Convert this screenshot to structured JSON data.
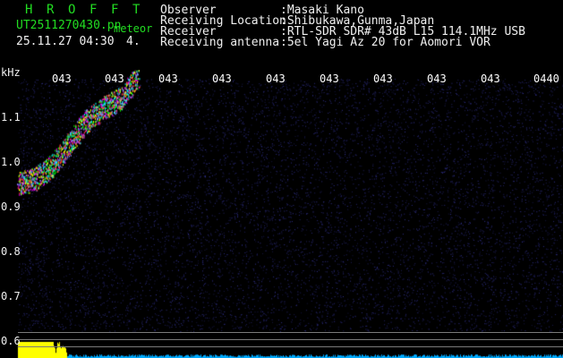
{
  "station": {
    "name_letters": [
      "H",
      "R",
      "O",
      "F",
      "F",
      "T"
    ],
    "file_name": "UT2511270430.pn",
    "file_suffix": "meteor",
    "date_time": "25.11.27 04:30",
    "count": "4."
  },
  "metadata": [
    {
      "label": "Observer",
      "value": ":Masaki Kano"
    },
    {
      "label": "Receiving Location",
      "value": ":Shibukawa,Gunma,Japan"
    },
    {
      "label": "Receiver",
      "value": ":RTL-SDR SDR# 43dB L15 114.1MHz USB"
    },
    {
      "label": "Receiving antenna",
      "value": ":5el Yagi Az 20 for Aomori VOR"
    }
  ],
  "axis": {
    "y_unit": "kHz",
    "y_ticks": [
      "1.1",
      "1.0",
      "0.9",
      "0.8",
      "0.7",
      "0.6"
    ],
    "x_ticks": [
      "043",
      "043",
      "043",
      "043",
      "043",
      "043",
      "043",
      "043",
      "043",
      "0440"
    ]
  },
  "chart_data": {
    "type": "heatmap",
    "ylabel": "kHz",
    "ylim": [
      0.6,
      1.2
    ],
    "x_ticks": [
      "043",
      "043",
      "043",
      "043",
      "043",
      "043",
      "043",
      "043",
      "043",
      "0440"
    ],
    "y_ticks": [
      1.1,
      1.0,
      0.9,
      0.8,
      0.7,
      0.6
    ],
    "signal_trace": {
      "description_x_minutes": [
        0,
        0.2,
        0.4,
        0.6,
        0.8,
        1.0,
        1.2,
        1.4
      ],
      "freq_khz": [
        0.95,
        0.96,
        0.99,
        1.04,
        1.09,
        1.12,
        1.14,
        1.19
      ]
    },
    "colors": {
      "background": "#000000",
      "noise": "#1a1a6a",
      "signal_high": "#ffff00",
      "signal_mid": "#ff00ff"
    }
  }
}
